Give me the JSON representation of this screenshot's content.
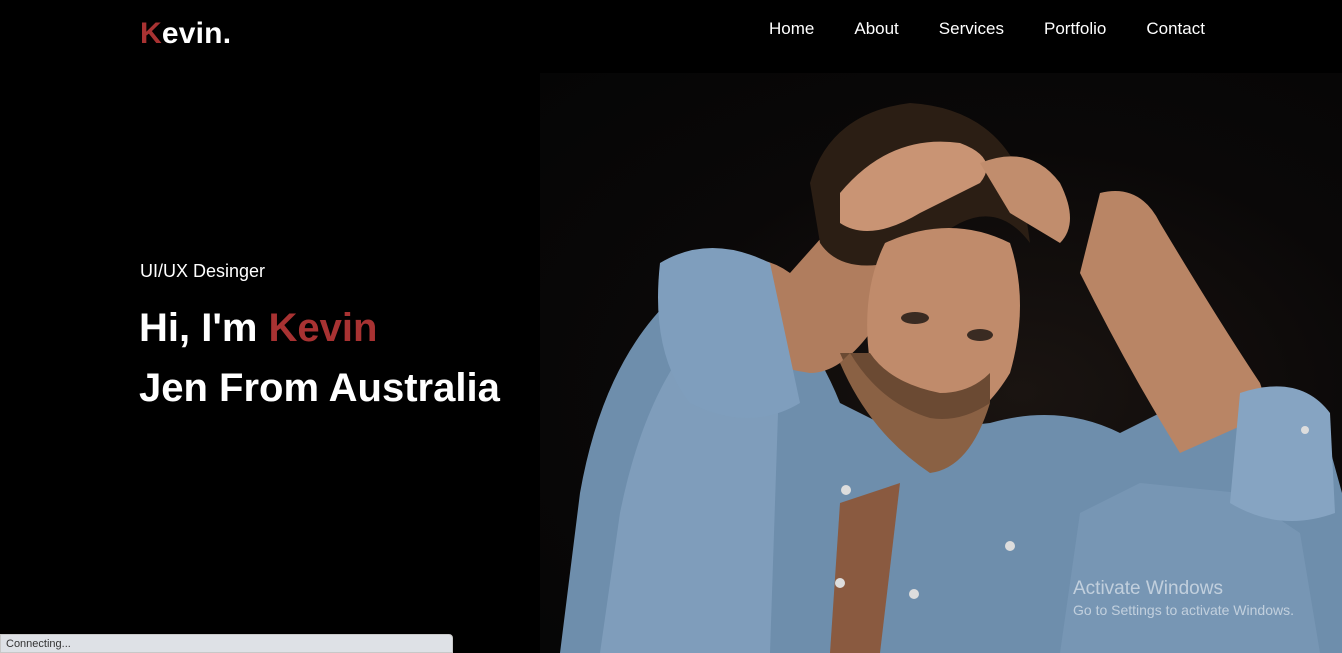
{
  "header": {
    "logo_first": "K",
    "logo_rest": "evin."
  },
  "nav": [
    {
      "label": "Home"
    },
    {
      "label": "About"
    },
    {
      "label": "Services"
    },
    {
      "label": "Portfolio"
    },
    {
      "label": "Contact"
    }
  ],
  "hero": {
    "role": "UI/UX Desinger",
    "greeting": "Hi, I'm ",
    "name": "Kevin",
    "line2": "Jen From Australia"
  },
  "watermark": {
    "title": "Activate Windows",
    "subtitle": "Go to Settings to activate Windows."
  },
  "status_bar": {
    "text": "Connecting..."
  },
  "colors": {
    "accent": "#a83232",
    "background": "#000000"
  }
}
